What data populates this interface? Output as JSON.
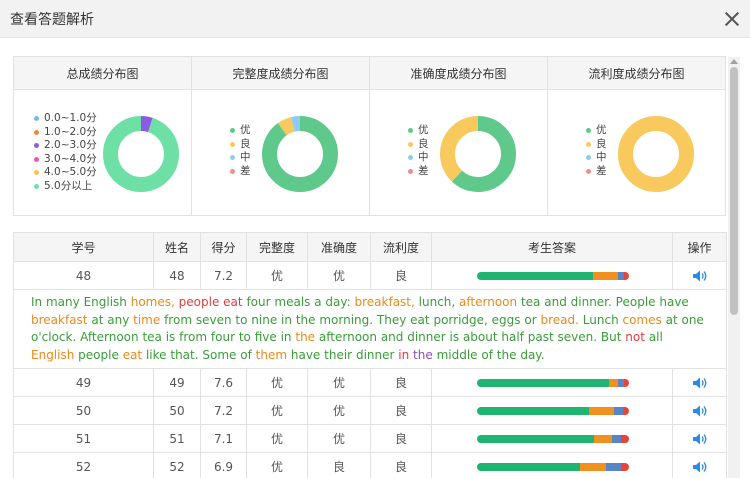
{
  "window": {
    "title": "查看答题解析"
  },
  "colors": {
    "c0": "#7ab8e8",
    "c1": "#f0883a",
    "c2": "#8a5ce6",
    "c3": "#ee5aa0",
    "c4": "#f6c453",
    "c5": "#6ee0a5",
    "you": "#5ec98a",
    "liang": "#f8c95c",
    "zhong": "#8ecbf0",
    "cha": "#f28b8b",
    "seg_green": "#1fb46f",
    "seg_orange": "#f0901e",
    "seg_blue": "#5a84c8",
    "seg_red": "#e8443a",
    "speaker": "#2a8ae6"
  },
  "charts": [
    {
      "title": "总成绩分布图",
      "legend": [
        "0.0~1.0分",
        "1.0~2.0分",
        "2.0~3.0分",
        "3.0~4.0分",
        "4.0~5.0分",
        "5.0分以上"
      ],
      "legend_colors": [
        "#7ab8e8",
        "#f0883a",
        "#8a5ce6",
        "#ee5aa0",
        "#f6c453",
        "#6ee0a5"
      ],
      "values": [
        0,
        0,
        5,
        0,
        0,
        95
      ]
    },
    {
      "title": "完整度成绩分布图",
      "legend": [
        "优",
        "良",
        "中",
        "差"
      ],
      "legend_colors": [
        "#5ec98a",
        "#f8c95c",
        "#8ecbf0",
        "#f28b8b"
      ],
      "values": [
        90,
        6,
        4,
        0
      ]
    },
    {
      "title": "准确度成绩分布图",
      "legend": [
        "优",
        "良",
        "中",
        "差"
      ],
      "legend_colors": [
        "#5ec98a",
        "#f8c95c",
        "#8ecbf0",
        "#f28b8b"
      ],
      "values": [
        62,
        38,
        0,
        0
      ]
    },
    {
      "title": "流利度成绩分布图",
      "legend": [
        "优",
        "良",
        "中",
        "差"
      ],
      "legend_colors": [
        "#5ec98a",
        "#f8c95c",
        "#8ecbf0",
        "#f28b8b"
      ],
      "values": [
        0,
        100,
        0,
        0
      ]
    }
  ],
  "table": {
    "headers": [
      "学号",
      "姓名",
      "得分",
      "完整度",
      "准确度",
      "流利度",
      "考生答案",
      "操作"
    ],
    "rows": [
      {
        "id": "48",
        "name": "48",
        "score": "7.2",
        "complete": "优",
        "accuracy": "优",
        "fluency": "良",
        "bar": [
          76,
          17,
          4,
          3
        ]
      },
      {
        "id": "49",
        "name": "49",
        "score": "7.6",
        "complete": "优",
        "accuracy": "优",
        "fluency": "良",
        "bar": [
          87,
          6,
          4,
          3
        ]
      },
      {
        "id": "50",
        "name": "50",
        "score": "7.2",
        "complete": "优",
        "accuracy": "优",
        "fluency": "良",
        "bar": [
          74,
          16,
          6,
          4
        ]
      },
      {
        "id": "51",
        "name": "51",
        "score": "7.1",
        "complete": "优",
        "accuracy": "优",
        "fluency": "良",
        "bar": [
          77,
          12,
          6,
          5
        ]
      },
      {
        "id": "52",
        "name": "52",
        "score": "6.9",
        "complete": "优",
        "accuracy": "良",
        "fluency": "良",
        "bar": [
          68,
          17,
          10,
          5
        ]
      }
    ],
    "answer_words": [
      [
        "In",
        "g"
      ],
      [
        "many",
        "g"
      ],
      [
        "English",
        "g"
      ],
      [
        "homes,",
        "o"
      ],
      [
        "people",
        "r"
      ],
      [
        "eat",
        "r"
      ],
      [
        "four",
        "g"
      ],
      [
        "meals",
        "g"
      ],
      [
        "a",
        "g"
      ],
      [
        "day:",
        "g"
      ],
      [
        "breakfast,",
        "o"
      ],
      [
        "lunch,",
        "g"
      ],
      [
        "afternoon",
        "o"
      ],
      [
        "tea",
        "g"
      ],
      [
        "and",
        "g"
      ],
      [
        "dinner.",
        "g"
      ],
      [
        "People",
        "g"
      ],
      [
        "have",
        "g"
      ],
      [
        "breakfast",
        "o"
      ],
      [
        "at",
        "g"
      ],
      [
        "any",
        "g"
      ],
      [
        "time",
        "o"
      ],
      [
        "from",
        "g"
      ],
      [
        "seven",
        "g"
      ],
      [
        "to",
        "g"
      ],
      [
        "nine",
        "g"
      ],
      [
        "in",
        "g"
      ],
      [
        "the",
        "g"
      ],
      [
        "morning.",
        "g"
      ],
      [
        "They",
        "g"
      ],
      [
        "eat",
        "g"
      ],
      [
        "porridge,",
        "g"
      ],
      [
        "eggs",
        "g"
      ],
      [
        "or",
        "g"
      ],
      [
        "bread.",
        "o"
      ],
      [
        "Lunch",
        "g"
      ],
      [
        "comes",
        "o"
      ],
      [
        "at",
        "g"
      ],
      [
        "one",
        "g"
      ],
      [
        "o'clock.",
        "g"
      ],
      [
        "Afternoon",
        "g"
      ],
      [
        "tea",
        "g"
      ],
      [
        "is",
        "g"
      ],
      [
        "from",
        "g"
      ],
      [
        "four",
        "g"
      ],
      [
        "to",
        "g"
      ],
      [
        "five",
        "g"
      ],
      [
        "in",
        "g"
      ],
      [
        "the",
        "o"
      ],
      [
        "afternoon",
        "g"
      ],
      [
        "and",
        "g"
      ],
      [
        "dinner",
        "g"
      ],
      [
        "is",
        "g"
      ],
      [
        "about",
        "g"
      ],
      [
        "half",
        "g"
      ],
      [
        "past",
        "g"
      ],
      [
        "seven.",
        "g"
      ],
      [
        "But",
        "g"
      ],
      [
        "not",
        "r"
      ],
      [
        "all",
        "g"
      ],
      [
        "English",
        "o"
      ],
      [
        "people",
        "g"
      ],
      [
        "eat",
        "o"
      ],
      [
        "like",
        "g"
      ],
      [
        "that.",
        "g"
      ],
      [
        "Some",
        "g"
      ],
      [
        "of",
        "g"
      ],
      [
        "them",
        "o"
      ],
      [
        "have",
        "g"
      ],
      [
        "their",
        "g"
      ],
      [
        "dinner",
        "g"
      ],
      [
        "in",
        "r"
      ],
      [
        "the",
        "p"
      ],
      [
        "middle",
        "g"
      ],
      [
        "of",
        "g"
      ],
      [
        "the",
        "g"
      ],
      [
        "day.",
        "g"
      ]
    ]
  }
}
